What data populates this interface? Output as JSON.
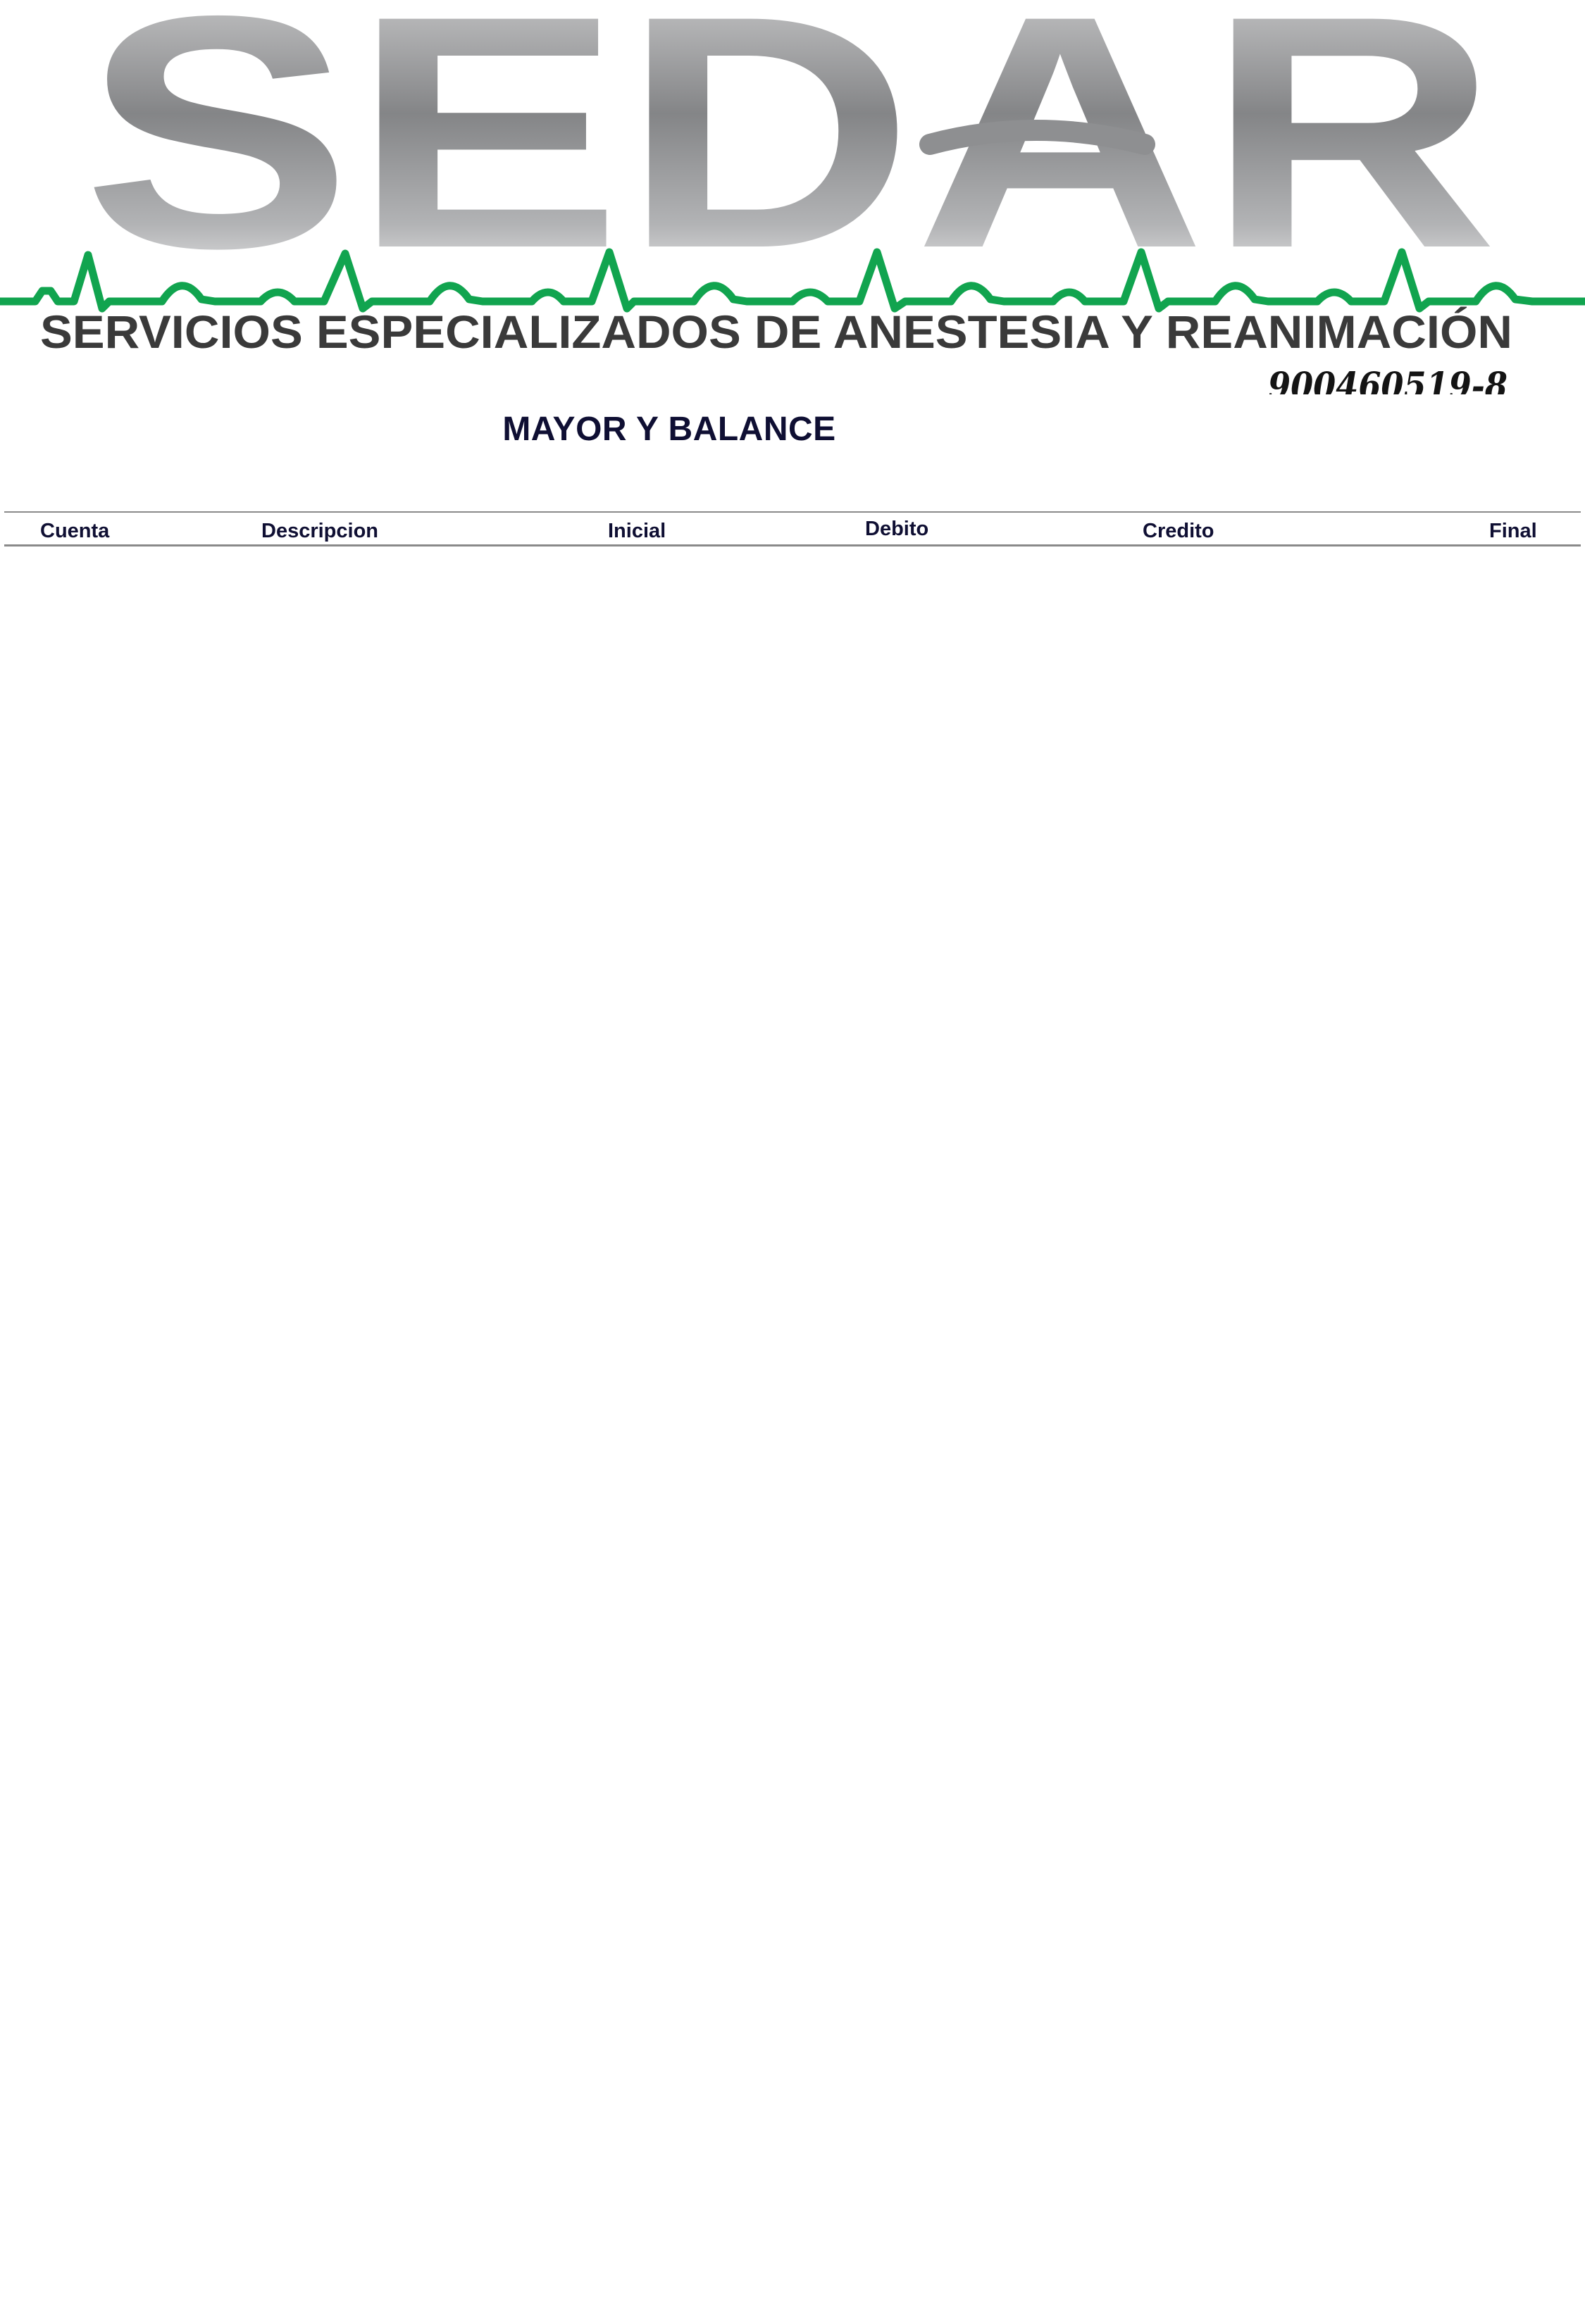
{
  "letterhead": {
    "logo_text": "SEDAR",
    "company_name": "SERVICIOS ESPECIALIZADOS DE ANESTESIA Y REANIMACIÓN",
    "tax_id": "900460519-8",
    "heartbeat_color": "#11a44f",
    "text_color": "#3a3a3a"
  },
  "document": {
    "title": "MAYOR Y BALANCE"
  },
  "table": {
    "columns": [
      "Cuenta",
      "Descripcion",
      "Inicial",
      "Debito",
      "Credito",
      "Final"
    ],
    "rows": []
  }
}
